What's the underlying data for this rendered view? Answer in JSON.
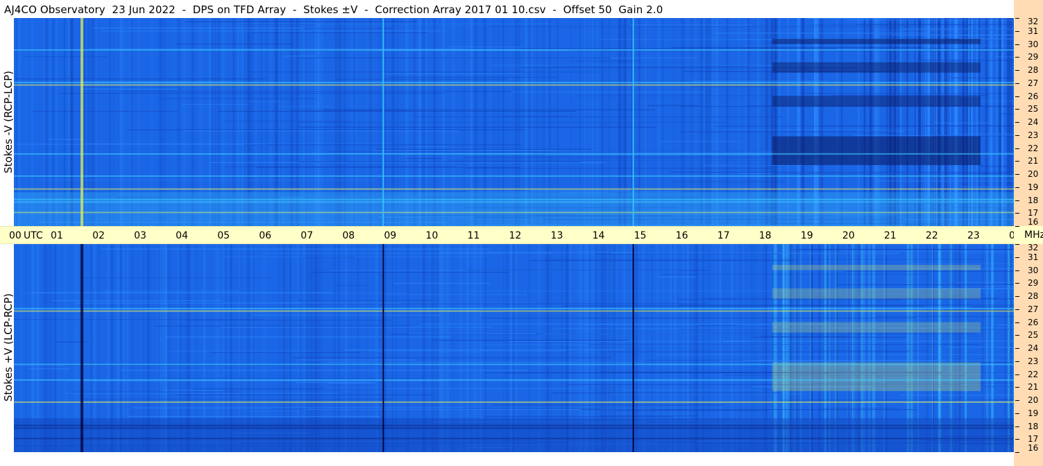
{
  "title": "AJ4CO Observatory  23 Jun 2022  -  DPS on TFD Array  -  Stokes ±V  -  Correction Array 2017 01 10.csv  -  Offset 50  Gain 2.0",
  "chart_data": {
    "type": "heatmap",
    "title": "AJ4CO Observatory  23 Jun 2022  -  DPS on TFD Array  -  Stokes ±V  -  Correction Array 2017 01 10.csv  -  Offset 50  Gain 2.0",
    "x_ticks": [
      "00",
      "UTC",
      "01",
      "02",
      "03",
      "04",
      "05",
      "06",
      "07",
      "08",
      "09",
      "10",
      "11",
      "12",
      "13",
      "14",
      "15",
      "16",
      "17",
      "18",
      "19",
      "20",
      "21",
      "22",
      "23",
      "00",
      "MHz"
    ],
    "x_range_utc_hours": [
      0,
      24
    ],
    "y_ticks": [
      "32",
      "31",
      "30",
      "29",
      "28",
      "27",
      "26",
      "25",
      "24",
      "23",
      "22",
      "21",
      "20",
      "19",
      "18",
      "17",
      "16"
    ],
    "y_range_mhz": [
      16,
      32
    ],
    "panels": [
      {
        "name": "top",
        "ylabel": "Stokes -V (RCP-LCP)",
        "base_color": "#1a5fe0",
        "vertical_lines_utc": [
          1.6,
          8.85,
          14.85
        ],
        "vertical_line_color": "#33c6ff",
        "bright_bands_mhz": [
          17.1,
          17.9,
          18.1,
          18.9,
          19.9,
          21.6,
          26.9,
          27.1,
          29.6
        ]
      },
      {
        "name": "bottom",
        "ylabel": "Stokes +V (LCP-RCP)",
        "base_color": "#1a5fe0",
        "vertical_lines_utc": [
          1.6,
          8.85,
          14.85
        ],
        "vertical_line_color": "#000033",
        "bright_bands_mhz": [
          17.1,
          17.9,
          18.1,
          19.9,
          21.6,
          22.8,
          26.9,
          27.1
        ]
      }
    ],
    "legend": "none",
    "grid": false
  },
  "colors": {
    "time_axis_bg": "#ffffc8",
    "freq_axis_bg": "#ffdcb4",
    "field_deep": "#1040b8",
    "field_mid": "#1a66e6",
    "field_light": "#2f8cff",
    "field_cyan": "#3fd0ff",
    "field_yellow": "#e6f05a",
    "field_dark": "#0a1860"
  }
}
